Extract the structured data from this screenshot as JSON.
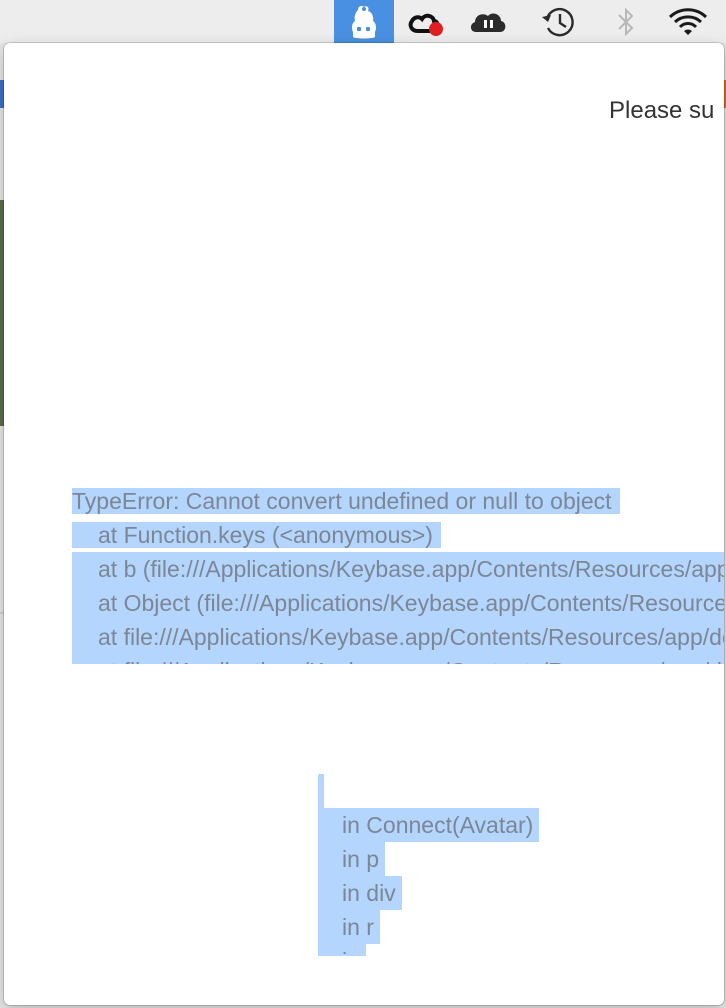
{
  "menubar": {
    "items": [
      {
        "icon": "keybase-icon",
        "state": "active"
      },
      {
        "icon": "creative-cloud-icon",
        "badge": "red-dot"
      },
      {
        "icon": "cloud-sync-paused-icon"
      },
      {
        "icon": "time-machine-icon"
      },
      {
        "icon": "bluetooth-icon"
      },
      {
        "icon": "wifi-icon"
      }
    ],
    "colors": {
      "active_bg": "#4a90e2",
      "badge": "#e02020"
    }
  },
  "window": {
    "partial_heading": "Please su",
    "error": {
      "lines": [
        "TypeError: Cannot convert undefined or null to object",
        "at Function.keys (<anonymous>)",
        "at b (file:///Applications/Keybase.app/Contents/Resources/app/desktop/dist/main.bundle.js",
        "at Object (file:///Applications/Keybase.app/Contents/Resources/app/desktop/dist/main.bundle.js",
        "at file:///Applications/Keybase.app/Contents/Resources/app/desktop/dist/main.bundle.js",
        "at file:///Applications/Keybase.app/Contents/Resources/app/desktop/dist/main.bundle.js"
      ]
    },
    "component_stack": {
      "lines": [
        "in Connect(Avatar)",
        "in p",
        "in div",
        "in r",
        "in"
      ]
    },
    "colors": {
      "selection": "#b4d5fe",
      "error_text": "#7c8795"
    }
  }
}
